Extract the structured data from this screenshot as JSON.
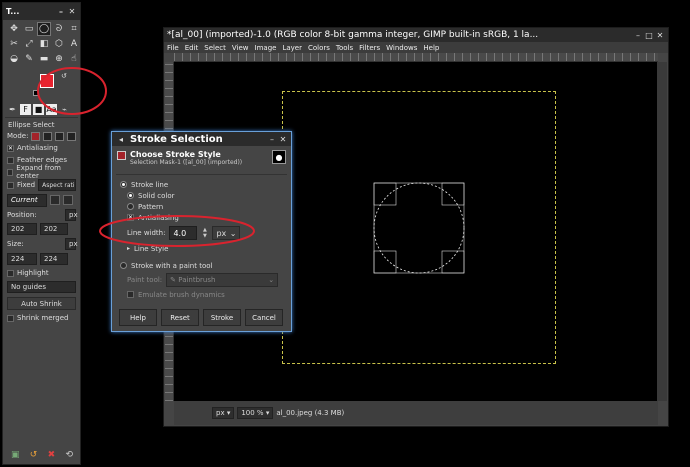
{
  "toolbox": {
    "title": "T...",
    "tool_options_title": "Ellipse Select",
    "mode_label": "Mode:",
    "antialiasing": "Antialiasing",
    "feather_edges": "Feather edges",
    "expand_from_center": "Expand from center",
    "fixed": "Fixed",
    "aspect_ratio": "Aspect ratio",
    "current": "Current",
    "position_label": "Position:",
    "position_unit": "px",
    "position_x": "202",
    "position_y": "202",
    "size_label": "Size:",
    "size_unit": "px",
    "size_w": "224",
    "size_h": "224",
    "highlight": "Highlight",
    "guides": "No guides",
    "auto_shrink": "Auto Shrink",
    "shrink_merged": "Shrink merged",
    "fg_color": "#e8232f"
  },
  "image_window": {
    "title": "*[al_00] (imported)-1.0 (RGB color 8-bit gamma integer, GIMP built-in sRGB, 1 la...",
    "menus": [
      "File",
      "Edit",
      "Select",
      "View",
      "Image",
      "Layer",
      "Colors",
      "Tools",
      "Filters",
      "Windows",
      "Help"
    ],
    "status_unit": "px",
    "status_zoom": "100 %",
    "status_file": "al_00.jpeg (4.3 MB)"
  },
  "dialog": {
    "title": "Stroke Selection",
    "header_title": "Choose Stroke Style",
    "header_subtitle": "Selection Mask-1 ([al_00] (imported))",
    "stroke_line": "Stroke line",
    "solid_color": "Solid color",
    "pattern": "Pattern",
    "antialiasing": "Antialiasing",
    "line_width_label": "Line width:",
    "line_width_value": "4.0",
    "line_width_unit": "px",
    "line_style": "Line Style",
    "stroke_paint_tool": "Stroke with a paint tool",
    "paint_tool_label": "Paint tool:",
    "paint_tool_value": "Paintbrush",
    "emulate": "Emulate brush dynamics",
    "buttons": {
      "help": "Help",
      "reset": "Reset",
      "stroke": "Stroke",
      "cancel": "Cancel"
    }
  },
  "annotation_color": "#d9232e"
}
